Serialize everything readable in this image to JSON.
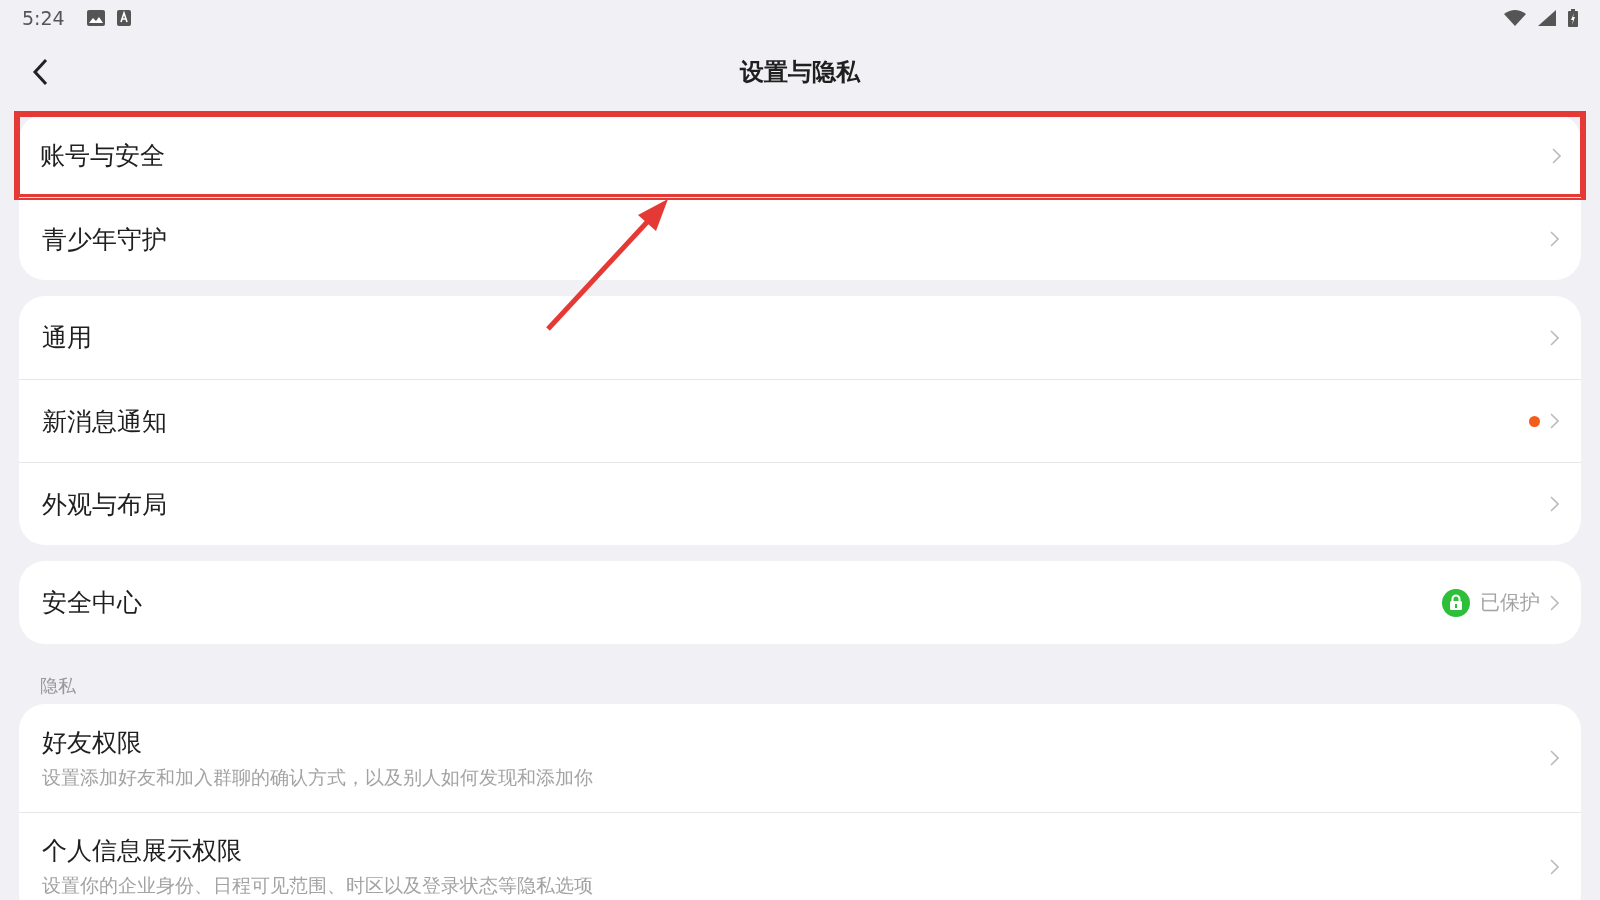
{
  "status_bar": {
    "time": "5:24"
  },
  "header": {
    "title": "设置与隐私"
  },
  "groups": [
    {
      "items": [
        {
          "title": "账号与安全",
          "highlighted": true
        },
        {
          "title": "青少年守护",
          "highlighted": false
        }
      ]
    },
    {
      "items": [
        {
          "title": "通用",
          "highlighted": false
        },
        {
          "title": "新消息通知",
          "highlighted": false,
          "badge": {
            "kind": "dot",
            "color": "#f25c1f"
          }
        },
        {
          "title": "外观与布局",
          "highlighted": false
        }
      ]
    },
    {
      "items": [
        {
          "title": "安全中心",
          "highlighted": false,
          "badge": {
            "kind": "status",
            "text": "已保护"
          }
        }
      ]
    },
    {
      "label": "隐私",
      "items": [
        {
          "title": "好友权限",
          "highlighted": false,
          "subtitle": "设置添加好友和加入群聊的确认方式，以及别人如何发现和添加你"
        },
        {
          "title": "个人信息展示权限",
          "highlighted": false,
          "subtitle": "设置你的企业身份、日程可见范围、时区以及登录状态等隐私选项"
        }
      ]
    }
  ]
}
